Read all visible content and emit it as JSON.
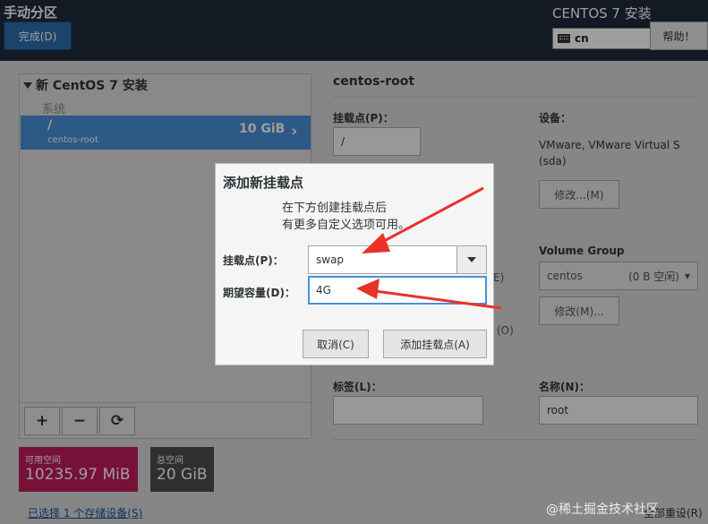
{
  "header": {
    "page_title": "手动分区",
    "done_label": "完成(D)",
    "install_title": "CENTOS 7 安装",
    "keyboard_layout": "cn",
    "help_label": "帮助！"
  },
  "left": {
    "group_title": "新 CentOS 7 安装",
    "system_label": "系统",
    "partition": {
      "mount": "/",
      "name": "centos-root",
      "size": "10 GiB"
    },
    "add_label": "+",
    "remove_label": "−",
    "refresh_label": "⟳",
    "available_label": "可用空间",
    "available_value": "10235.97 MiB",
    "total_label": "总空间",
    "total_value": "20 GiB",
    "storage_link": "已选择 1 个存储设备(S)"
  },
  "right": {
    "title": "centos-root",
    "mountpoint_label": "挂载点(P)：",
    "mountpoint_value": "/",
    "device_label": "设备：",
    "device_text": "VMware, VMware Virtual S (sda)",
    "modify_label": "修改...(M)",
    "vg_label": "Volume Group",
    "vg_name": "centos",
    "vg_free": "(0 B 空闲)",
    "vg_modify_label": "修改(M)...",
    "behind_e": "E)",
    "behind_o": "(O)",
    "tag_label": "标签(L)：",
    "name_label": "名称(N)：",
    "name_value": "root",
    "reset_label": "全部重设(R)"
  },
  "dialog": {
    "title": "添加新挂载点",
    "desc_line1": "在下方创建挂载点后",
    "desc_line2": "有更多自定义选项可用。",
    "mount_label": "挂载点(P)：",
    "mount_value": "swap",
    "capacity_label": "期望容量(D)：",
    "capacity_value": "4G",
    "cancel_label": "取消(C)",
    "add_label": "添加挂载点(A)"
  },
  "watermark": "@稀土掘金技术社区",
  "colors": {
    "topbar": "#1f2b39",
    "accent": "#4a90d9",
    "available": "#c01c5a",
    "total": "#4d4d4d",
    "arrow": "#e8322b"
  }
}
